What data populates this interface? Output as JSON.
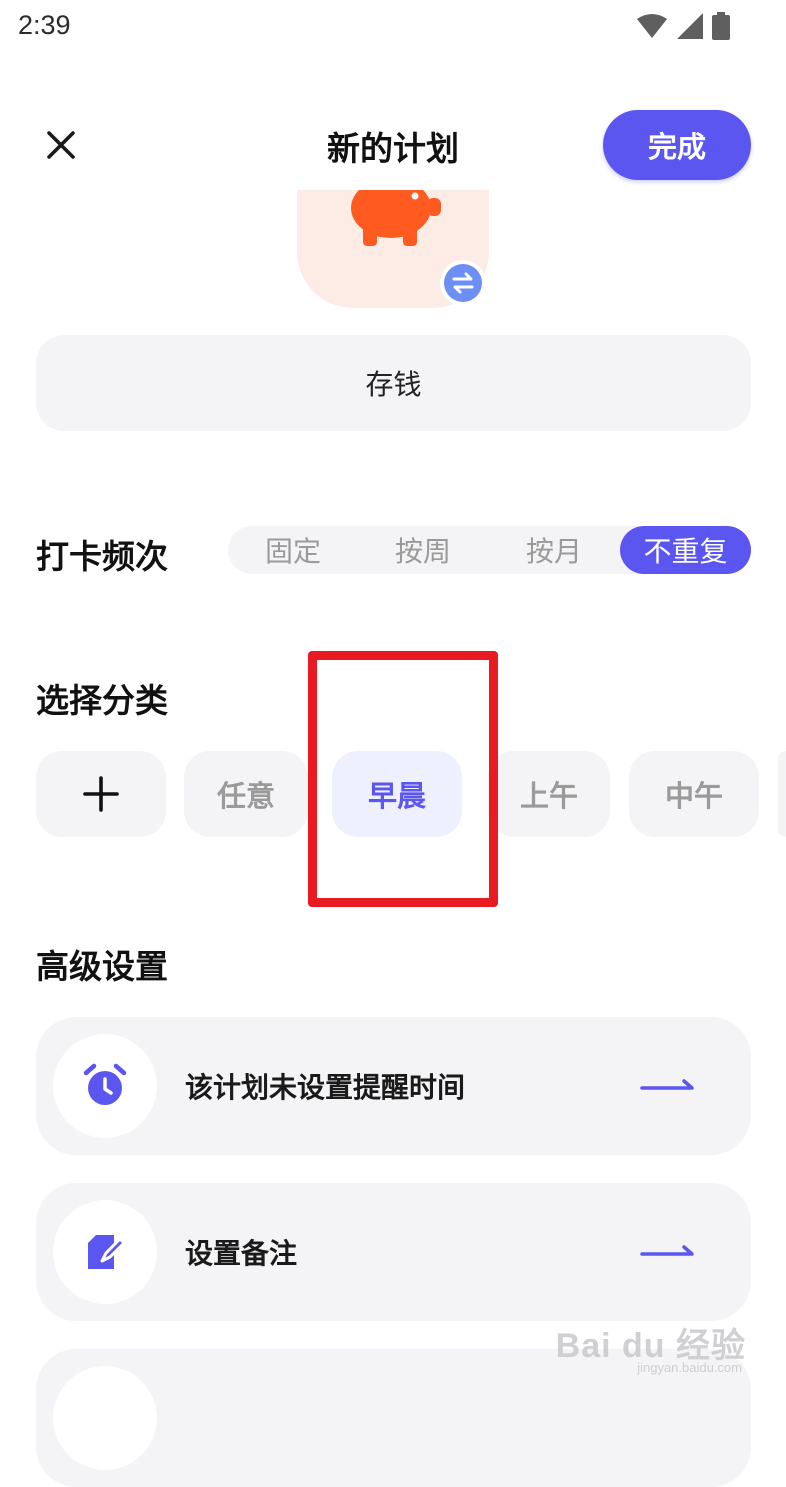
{
  "status_bar": {
    "time": "2:39",
    "icons": [
      "wifi-icon",
      "signal-icon",
      "battery-icon"
    ]
  },
  "header": {
    "title": "新的计划",
    "done_label": "完成",
    "close_icon": "close-icon"
  },
  "plan": {
    "icon": "piggy-bank-icon",
    "icon_bg_color": "#fdebe6",
    "icon_color": "#ff5a1f",
    "swap_icon": "swap-icon",
    "name": "存钱"
  },
  "frequency": {
    "title": "打卡频次",
    "options": [
      "固定",
      "按周",
      "按月",
      "不重复"
    ],
    "selected": "不重复"
  },
  "category": {
    "title": "选择分类",
    "add_icon": "plus-icon",
    "options": [
      "任意",
      "早晨",
      "上午",
      "中午"
    ],
    "selected": "早晨"
  },
  "advanced": {
    "title": "高级设置",
    "items": [
      {
        "icon": "alarm-clock-icon",
        "label": "该计划未设置提醒时间",
        "arrow_icon": "arrow-right-icon"
      },
      {
        "icon": "edit-note-icon",
        "label": "设置备注",
        "arrow_icon": "arrow-right-icon"
      }
    ]
  },
  "watermark": {
    "text": "Bai du 经验",
    "sub": "jingyan.baidu.com"
  },
  "colors": {
    "accent": "#5b56f0",
    "highlight_border": "#e81a22",
    "chip_bg": "#f4f4f6"
  }
}
